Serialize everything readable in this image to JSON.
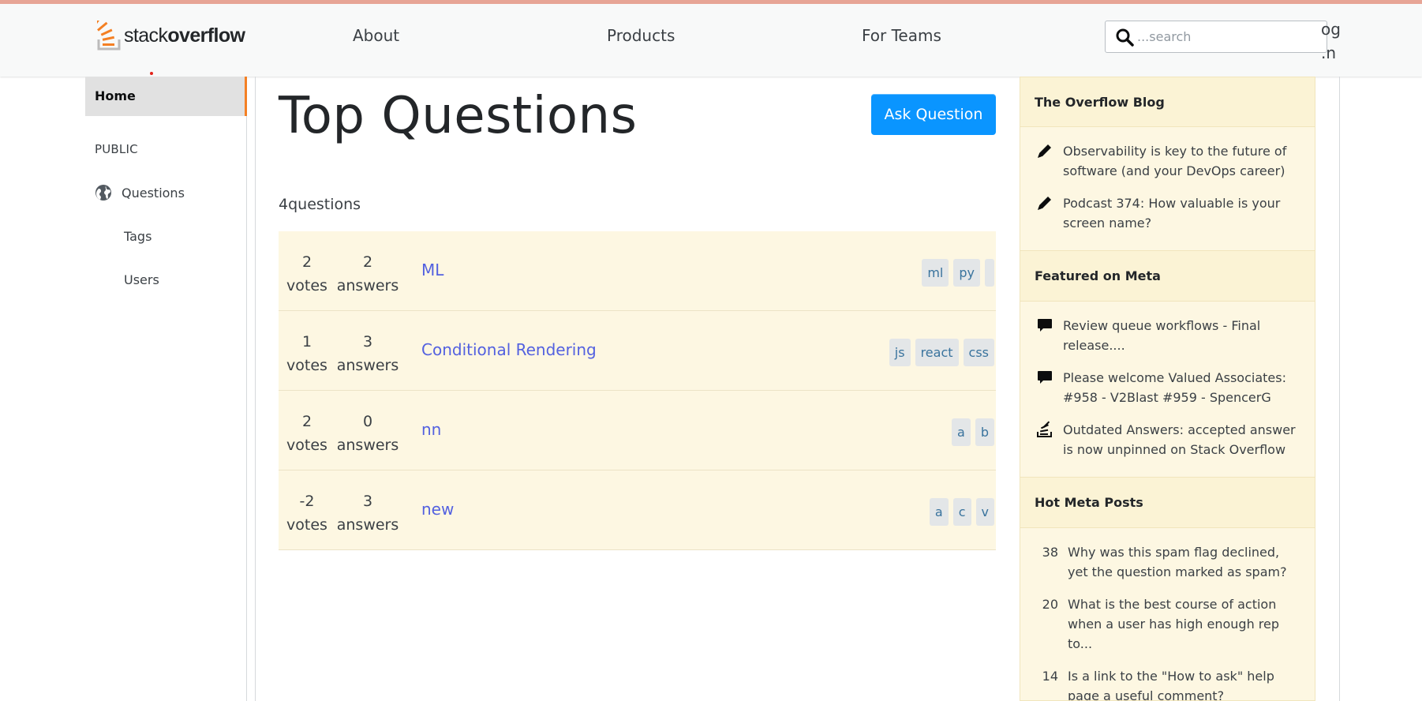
{
  "header": {
    "logo_text_light": "stack",
    "logo_text_bold": "overflow",
    "nav": [
      "About",
      "Products",
      "For Teams"
    ],
    "search_placeholder": "...search",
    "login_fragment": "og\n.n"
  },
  "left_sidebar": {
    "home": "Home",
    "public_label": "PUBLIC",
    "questions": "Questions",
    "tags": "Tags",
    "users": "Users"
  },
  "main": {
    "title": "Top Questions",
    "ask_button": "Ask Question",
    "question_count": "4questions",
    "questions": [
      {
        "votes": "2",
        "votes_label": "votes",
        "answers": "2",
        "answers_label": "answers",
        "title": "ML",
        "tags": [
          "ml",
          "py",
          ""
        ]
      },
      {
        "votes": "1",
        "votes_label": "votes",
        "answers": "3",
        "answers_label": "answers",
        "title": "Conditional Rendering",
        "tags": [
          "js",
          "react",
          "css"
        ]
      },
      {
        "votes": "2",
        "votes_label": "votes",
        "answers": "0",
        "answers_label": "answers",
        "title": "nn",
        "tags": [
          "a",
          "b"
        ]
      },
      {
        "votes": "-2",
        "votes_label": "votes",
        "answers": "3",
        "answers_label": "answers",
        "title": "new",
        "tags": [
          "a",
          "c",
          "v"
        ]
      }
    ]
  },
  "right_sidebar": {
    "blog": {
      "header": "The Overflow Blog",
      "items": [
        {
          "icon": "pencil-icon",
          "text": "Observability is key to the future of software (and your DevOps career)"
        },
        {
          "icon": "pencil-icon",
          "text": "Podcast 374: How valuable is your screen name?"
        }
      ]
    },
    "meta": {
      "header": "Featured on Meta",
      "items": [
        {
          "icon": "speech-bubble-icon",
          "text": "Review queue workflows - Final release...."
        },
        {
          "icon": "speech-bubble-icon",
          "text": "Please welcome Valued Associates: #958 - V2Blast #959 - SpencerG"
        },
        {
          "icon": "stackoverflow-icon",
          "text": "Outdated Answers: accepted answer is now unpinned on Stack Overflow"
        }
      ]
    },
    "hot": {
      "header": "Hot Meta Posts",
      "items": [
        {
          "count": "38",
          "text": "Why was this spam flag declined, yet the question marked as spam?"
        },
        {
          "count": "20",
          "text": "What is the best course of action when a user has high enough rep to..."
        },
        {
          "count": "14",
          "text": "Is a link to the \"How to ask\" help page a useful comment?"
        }
      ]
    }
  },
  "colors": {
    "accent_orange": "#f48024",
    "ask_button_blue": "#0a95ff",
    "question_link": "#5361e0",
    "widget_bg": "#fdf7e2"
  }
}
